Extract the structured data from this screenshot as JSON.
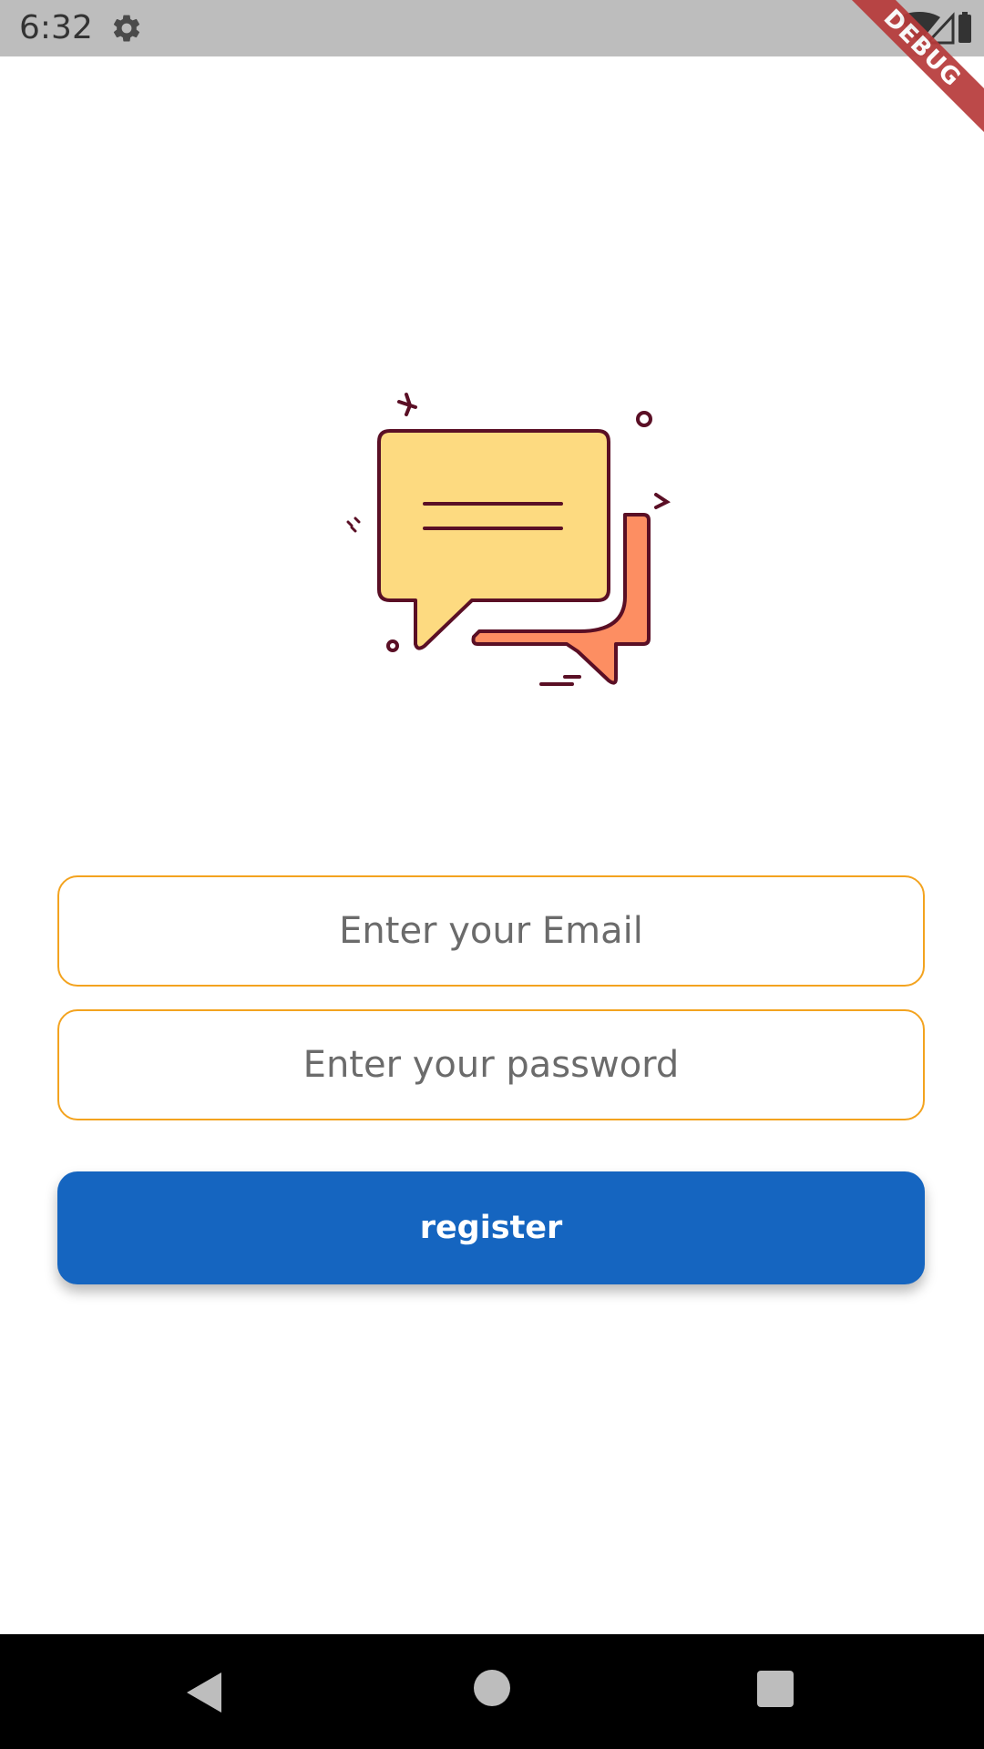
{
  "status_bar": {
    "time": "6:32",
    "debug_label": "DEBUG",
    "icons": [
      "gear-icon",
      "wifi-icon",
      "signal-icon",
      "battery-icon"
    ]
  },
  "illustration": {
    "icon": "chat-bubbles-icon",
    "colors": {
      "front_bubble": "#fdda80",
      "back_bubble": "#fd8e62",
      "outline": "#5a0f25"
    }
  },
  "form": {
    "email": {
      "value": "",
      "placeholder": "Enter your Email"
    },
    "password": {
      "value": "",
      "placeholder": "Enter your password"
    },
    "register_label": "register",
    "border_color": "#f3a31f",
    "button_color": "#1565c0"
  },
  "nav_bar": {
    "icons": [
      "back-icon",
      "home-icon",
      "recents-icon"
    ]
  }
}
